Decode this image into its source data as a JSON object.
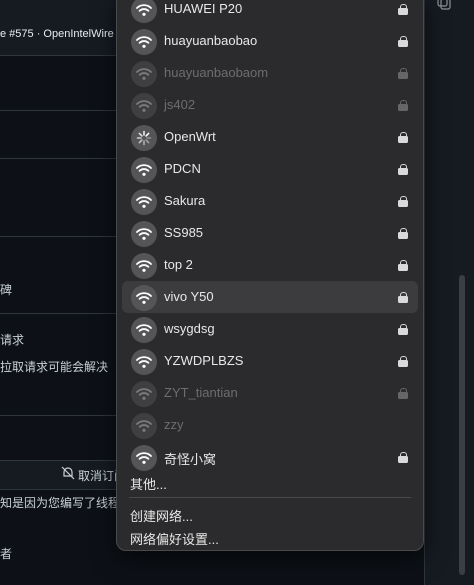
{
  "background": {
    "tab_title": "e #575 · OpenIntelWire",
    "texts": [
      {
        "text": "碑"
      },
      {
        "text": "请求"
      },
      {
        "text": "拉取请求可能会解决"
      },
      {
        "text": "知是因为您编写了线程"
      },
      {
        "text": "者"
      }
    ],
    "unsubscribe_label": "取消订阅"
  },
  "wifi_menu": {
    "networks": [
      {
        "name": "HUAWEI P20",
        "locked": true,
        "state": "normal"
      },
      {
        "name": "huayuanbaobao",
        "locked": true,
        "state": "normal"
      },
      {
        "name": "huayuanbaobaom",
        "locked": true,
        "state": "disabled"
      },
      {
        "name": "js402",
        "locked": true,
        "state": "disabled"
      },
      {
        "name": "OpenWrt",
        "locked": true,
        "state": "connecting"
      },
      {
        "name": "PDCN",
        "locked": true,
        "state": "normal"
      },
      {
        "name": "Sakura",
        "locked": true,
        "state": "normal"
      },
      {
        "name": "SS985",
        "locked": true,
        "state": "normal"
      },
      {
        "name": "top 2",
        "locked": true,
        "state": "normal"
      },
      {
        "name": "vivo Y50",
        "locked": true,
        "state": "selected"
      },
      {
        "name": "wsygdsg",
        "locked": true,
        "state": "normal"
      },
      {
        "name": "YZWDPLBZS",
        "locked": true,
        "state": "normal"
      },
      {
        "name": "ZYT_tiantian",
        "locked": true,
        "state": "disabled"
      },
      {
        "name": "zzy",
        "locked": false,
        "state": "disabled"
      },
      {
        "name": "奇怪小窝",
        "locked": true,
        "state": "normal"
      }
    ],
    "other_label": "其他...",
    "create_network_label": "创建网络...",
    "network_prefs_label": "网络偏好设置..."
  },
  "icons": {
    "network": "wifi-icon",
    "connecting": "spinner-icon",
    "secured": "lock-icon",
    "notifications": "bell-slash-icon",
    "copy": "copy-icon"
  },
  "colors": {
    "menu_bg": "#2b2b2d",
    "selected_row": "#3c3c3e",
    "icon_circle": "#555557",
    "text": "#e8e8e8",
    "disabled_text": "#6d6d70"
  }
}
